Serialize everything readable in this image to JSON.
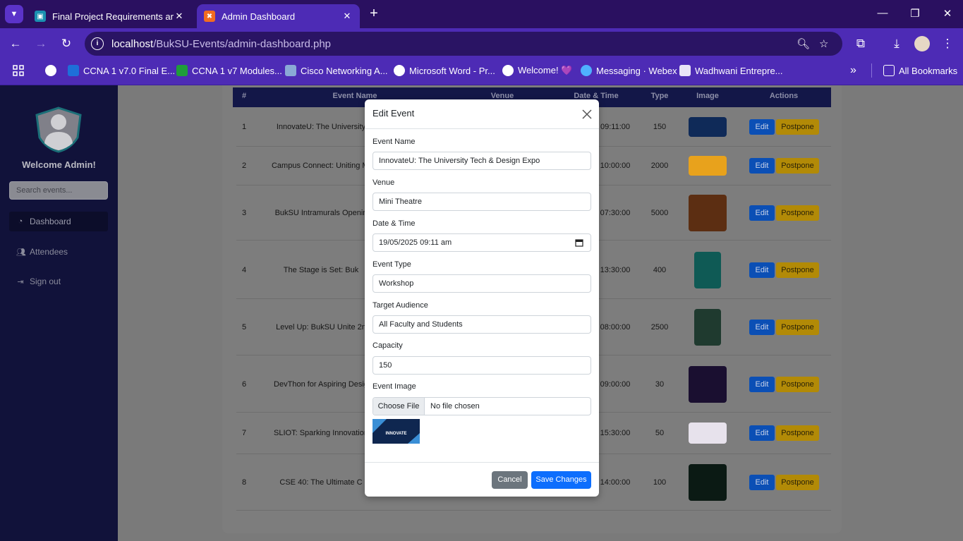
{
  "browser": {
    "tabs": [
      {
        "title": "Final Project Requirements and",
        "icon": "classroom-icon",
        "color": "#1e8e3e"
      },
      {
        "title": "Admin Dashboard",
        "icon": "xampp-icon",
        "color": "#f57c00"
      }
    ],
    "url_host": "localhost",
    "url_path": "/BukSU-Events/admin-dashboard.php",
    "bookmarks": [
      "CCNA 1 v7.0 Final E...",
      "CCNA 1 v7 Modules...",
      "Cisco Networking A...",
      "Microsoft Word - Pr...",
      "Welcome! 💜",
      "Messaging · Webex",
      "Wadhwani Entrepre..."
    ],
    "all_bookmarks": "All Bookmarks",
    "overflow": "»"
  },
  "sidebar": {
    "welcome": "Welcome Admin!",
    "search_placeholder": "Search events...",
    "items": [
      {
        "label": "Dashboard",
        "icon": "gauge-icon"
      },
      {
        "label": "Attendees",
        "icon": "users-icon"
      },
      {
        "label": "Sign out",
        "icon": "sign-out-icon"
      }
    ]
  },
  "table": {
    "headers": [
      "#",
      "Event Name",
      "Venue",
      "Date & Time",
      "Type",
      "Image",
      "Actions"
    ],
    "rows": [
      {
        "num": "1",
        "name": "InnovateU: The University",
        "time": "09:11:00",
        "type": "150"
      },
      {
        "num": "2",
        "name": "Campus Connect: Uniting Mi",
        "time": "10:00:00",
        "type": "2000"
      },
      {
        "num": "3",
        "name": "BukSU Intramurals Openin",
        "time": "07:30:00",
        "type": "5000"
      },
      {
        "num": "4",
        "name": "The Stage is Set: Buk",
        "time": "13:30:00",
        "type": "400"
      },
      {
        "num": "5",
        "name": "Level Up: BukSU Unite 2n",
        "time": "08:00:00",
        "type": "2500"
      },
      {
        "num": "6",
        "name": "DevThon for Aspiring Desig",
        "time": "09:00:00",
        "type": "30"
      },
      {
        "num": "7",
        "name": "SLIOT: Sparking Innovation",
        "time": "15:30:00",
        "type": "50"
      },
      {
        "num": "8",
        "name": "CSE 40: The Ultimate C",
        "time": "14:00:00",
        "type": "100"
      }
    ],
    "edit_label": "Edit",
    "postpone_label": "Postpone"
  },
  "modal": {
    "title": "Edit Event",
    "fields": {
      "event_name_label": "Event Name",
      "event_name": "InnovateU: The University Tech & Design Expo",
      "venue_label": "Venue",
      "venue": "Mini Theatre",
      "datetime_label": "Date & Time",
      "datetime": "19/05/2025 09:11 am",
      "type_label": "Event Type",
      "type": "Workshop",
      "audience_label": "Target Audience",
      "audience": "All Faculty and Students",
      "capacity_label": "Capacity",
      "capacity": "150",
      "image_label": "Event Image",
      "choose_file": "Choose File",
      "no_file": "No file chosen",
      "preview_text": "INNOVATE"
    },
    "cancel": "Cancel",
    "save": "Save Changes"
  }
}
